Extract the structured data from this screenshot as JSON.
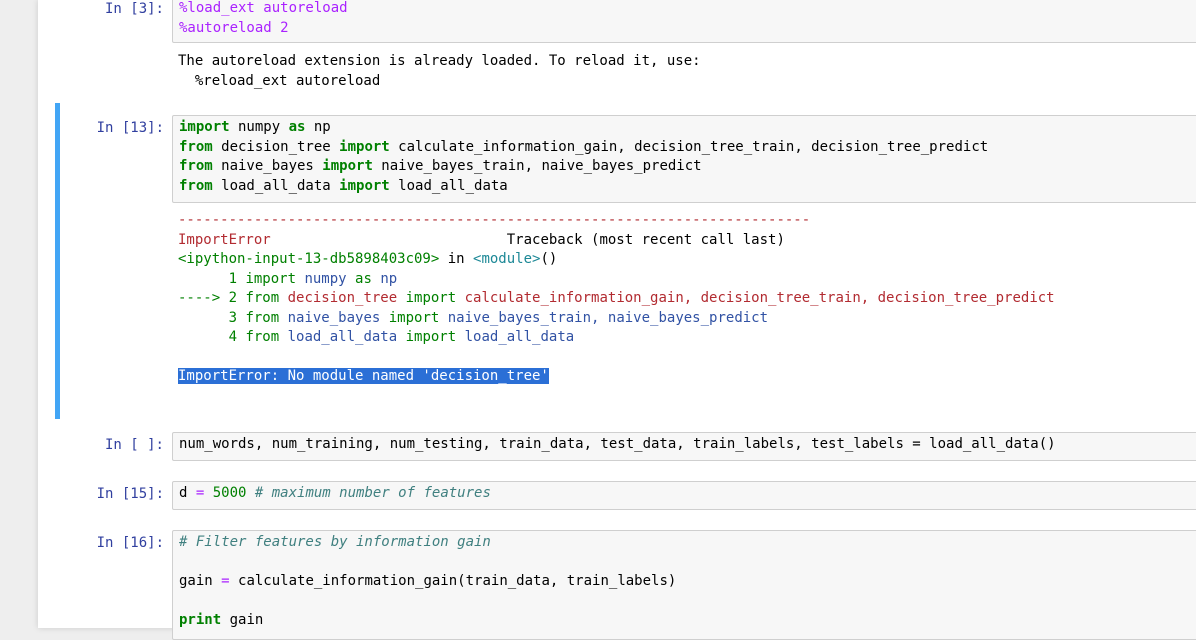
{
  "cells": {
    "c3": {
      "prompt": "In [3]:",
      "lines": [
        "%load_ext autoreload",
        "%autoreload 2"
      ],
      "output": [
        "The autoreload extension is already loaded. To reload it, use:",
        "  %reload_ext autoreload"
      ]
    },
    "c13": {
      "prompt": "In [13]:",
      "code": {
        "l1a": "import",
        "l1b": " numpy ",
        "l1c": "as",
        "l1d": " np",
        "l2a": "from",
        "l2b": " decision_tree ",
        "l2c": "import",
        "l2d": " calculate_information_gain, decision_tree_train, decision_tree_predict",
        "l3a": "from",
        "l3b": " naive_bayes ",
        "l3c": "import",
        "l3d": " naive_bayes_train, naive_bayes_predict",
        "l4a": "from",
        "l4b": " load_all_data ",
        "l4c": "import",
        "l4d": " load_all_data"
      },
      "traceback": {
        "dashes": "---------------------------------------------------------------------------",
        "err_name": "ImportError",
        "tb_label": "                            Traceback (most recent call last)",
        "input_ref": "<ipython-input-13-db5898403c09>",
        "in_word": " in ",
        "module": "<module>",
        "module_end": "()",
        "l1_num": "      1 ",
        "l1_kw": "import",
        "l1_a": " numpy ",
        "l1_as": "as",
        "l1_b": " np",
        "l2_arrow": "----> 2 ",
        "l2_kw": "from",
        "l2_a": " decision_tree ",
        "l2_imp": "import",
        "l2_b": " calculate_information_gain, decision_tree_train, decision_tree_predict",
        "l3_num": "      3 ",
        "l3_kw": "from",
        "l3_a": " naive_bayes ",
        "l3_imp": "import",
        "l3_b": " naive_bayes_train, naive_bayes_predict",
        "l4_num": "      4 ",
        "l4_kw": "from",
        "l4_a": " load_all_data ",
        "l4_imp": "import",
        "l4_b": " load_all_data",
        "final_error": "ImportError: No module named 'decision_tree'"
      }
    },
    "cblank": {
      "prompt": "In [ ]:",
      "code": "num_words, num_training, num_testing, train_data, test_data, train_labels, test_labels = load_all_data()"
    },
    "c15": {
      "prompt": "In [15]:",
      "a": "d ",
      "op": "=",
      "sp": " ",
      "num": "5000",
      "comment": " # maximum number of features"
    },
    "c16": {
      "prompt": "In [16]:",
      "comment": "# Filter features by information gain",
      "gain_a": "gain ",
      "gain_op": "=",
      "gain_b": " calculate_information_gain(train_data, train_labels)",
      "print_kw": "print",
      "print_b": " gain"
    }
  }
}
